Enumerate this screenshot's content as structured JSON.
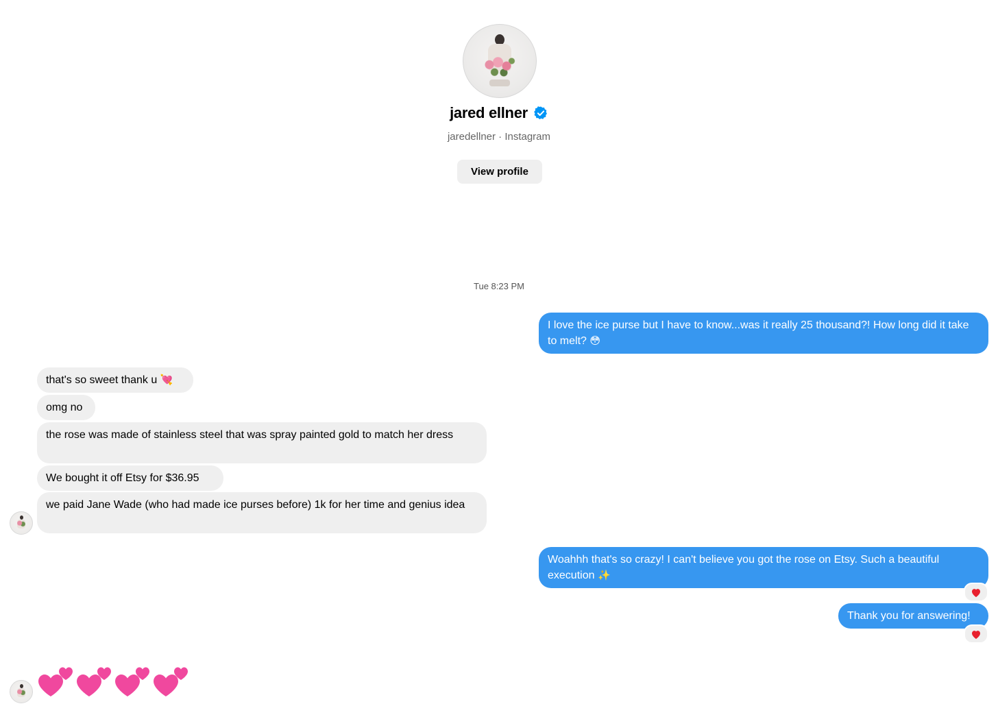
{
  "header": {
    "name": "jared ellner",
    "subtitle": "jaredellner · Instagram",
    "view_profile_label": "View profile"
  },
  "thread": {
    "timestamp": "Tue 8:23 PM",
    "messages": [
      {
        "from": "me",
        "text": "I love the ice purse but I have to know...was it really 25 thousand?! How long did it take to melt?",
        "emoji": "😳"
      },
      {
        "from": "them",
        "text": "that's so sweet thank u",
        "emoji": "💘"
      },
      {
        "from": "them",
        "text": "omg no"
      },
      {
        "from": "them",
        "text": "the rose was made of stainless steel that was spray painted gold to match her dress"
      },
      {
        "from": "them",
        "text": "We bought it off Etsy for $36.95"
      },
      {
        "from": "them",
        "text": "we paid Jane Wade (who had made ice purses before) 1k for her time and genius idea"
      },
      {
        "from": "me",
        "text": "Woahhh that's so crazy! I can't believe you got the rose on Etsy. Such a beautiful execution",
        "emoji": "✨",
        "reaction": "heart"
      },
      {
        "from": "me",
        "text": "Thank you for answering!",
        "reaction": "heart"
      },
      {
        "from": "them",
        "emoji_message": "💕💕💕💕"
      }
    ]
  },
  "colors": {
    "outgoing_bubble": "#3797f0",
    "incoming_bubble": "#efefef",
    "verified_badge": "#0095f6",
    "reaction_heart": "#e8202e",
    "emoji_heart": "#f0489e"
  }
}
